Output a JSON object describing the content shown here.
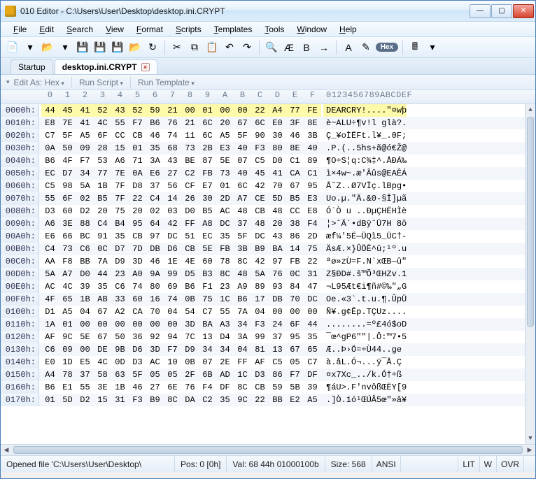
{
  "window": {
    "title": "010 Editor - C:\\Users\\User\\Desktop\\desktop.ini.CRYPT"
  },
  "menu": [
    "File",
    "Edit",
    "Search",
    "View",
    "Format",
    "Scripts",
    "Templates",
    "Tools",
    "Window",
    "Help"
  ],
  "tabs": [
    {
      "label": "Startup",
      "active": false,
      "closable": false
    },
    {
      "label": "desktop.ini.CRYPT",
      "active": true,
      "closable": true
    }
  ],
  "filterbar": {
    "edit_as": "Edit As: Hex",
    "run_script": "Run Script",
    "run_template": "Run Template"
  },
  "column_header": {
    "hex": [
      "0",
      "1",
      "2",
      "3",
      "4",
      "5",
      "6",
      "7",
      "8",
      "9",
      "A",
      "B",
      "C",
      "D",
      "E",
      "F"
    ],
    "ascii": "0123456789ABCDEF"
  },
  "hex_rows": [
    {
      "addr": "0000h:",
      "hex": [
        "44",
        "45",
        "41",
        "52",
        "43",
        "52",
        "59",
        "21",
        "00",
        "01",
        "00",
        "00",
        "22",
        "A4",
        "77",
        "FE"
      ],
      "ascii": "DEARCRY!....\"¤wþ",
      "hl": true
    },
    {
      "addr": "0010h:",
      "hex": [
        "E8",
        "7E",
        "41",
        "4C",
        "55",
        "F7",
        "B6",
        "76",
        "21",
        "6C",
        "20",
        "67",
        "6C",
        "E0",
        "3F",
        "8E"
      ],
      "ascii": "è~ALU÷¶v!l glà?.",
      "hl": false
    },
    {
      "addr": "0020h:",
      "hex": [
        "C7",
        "5F",
        "A5",
        "6F",
        "CC",
        "CB",
        "46",
        "74",
        "11",
        "6C",
        "A5",
        "5F",
        "90",
        "30",
        "46",
        "3B"
      ],
      "ascii": "Ç_¥oÌËFt.l¥_.0F;",
      "hl": false
    },
    {
      "addr": "0030h:",
      "hex": [
        "0A",
        "50",
        "09",
        "28",
        "15",
        "01",
        "35",
        "68",
        "73",
        "2B",
        "E3",
        "40",
        "F3",
        "80",
        "8E",
        "40"
      ],
      "ascii": ".P.(..5hs+ã@ó€Ž@",
      "hl": false
    },
    {
      "addr": "0040h:",
      "hex": [
        "B6",
        "4F",
        "F7",
        "53",
        "A6",
        "71",
        "3A",
        "43",
        "BE",
        "87",
        "5E",
        "07",
        "C5",
        "D0",
        "C1",
        "89"
      ],
      "ascii": "¶O÷S¦q:C¾‡^.ÅÐÁ‰",
      "hl": false
    },
    {
      "addr": "0050h:",
      "hex": [
        "EC",
        "D7",
        "34",
        "77",
        "7E",
        "0A",
        "E6",
        "27",
        "C2",
        "FB",
        "73",
        "40",
        "45",
        "41",
        "CA",
        "C1"
      ],
      "ascii": "ì×4w~.æ'Âûs@EAÊÁ",
      "hl": false
    },
    {
      "addr": "0060h:",
      "hex": [
        "C5",
        "98",
        "5A",
        "1B",
        "7F",
        "D8",
        "37",
        "56",
        "CF",
        "E7",
        "01",
        "6C",
        "42",
        "70",
        "67",
        "95"
      ],
      "ascii": "Å˜Z..Ø7VÏç.lBpg•",
      "hl": false
    },
    {
      "addr": "0070h:",
      "hex": [
        "55",
        "6F",
        "02",
        "B5",
        "7F",
        "22",
        "C4",
        "14",
        "26",
        "30",
        "2D",
        "A7",
        "CE",
        "5D",
        "B5",
        "E3"
      ],
      "ascii": "Uo.µ.\"Ä.&0-§Î]µã",
      "hl": false
    },
    {
      "addr": "0080h:",
      "hex": [
        "D3",
        "60",
        "D2",
        "20",
        "75",
        "20",
        "02",
        "03",
        "D0",
        "B5",
        "AC",
        "48",
        "CB",
        "48",
        "CC",
        "E8"
      ],
      "ascii": "Ó`Ò u ..ÐµÇHËHÌè",
      "hl": false
    },
    {
      "addr": "0090h:",
      "hex": [
        "A6",
        "3E",
        "88",
        "C4",
        "B4",
        "95",
        "64",
        "42",
        "FF",
        "A8",
        "DC",
        "37",
        "48",
        "20",
        "38",
        "F4"
      ],
      "ascii": "¦>ˆÄ´•dBÿ¨Ü7H 8ô",
      "hl": false
    },
    {
      "addr": "00A0h:",
      "hex": [
        "E6",
        "66",
        "BC",
        "91",
        "35",
        "CB",
        "97",
        "DC",
        "51",
        "EC",
        "35",
        "5F",
        "DC",
        "43",
        "86",
        "2D"
      ],
      "ascii": "æf¼'5Ë—ÜQì5_ÜC†-",
      "hl": false
    },
    {
      "addr": "00B0h:",
      "hex": [
        "C4",
        "73",
        "C6",
        "0C",
        "D7",
        "7D",
        "DB",
        "D6",
        "CB",
        "5E",
        "FB",
        "3B",
        "B9",
        "BA",
        "14",
        "75"
      ],
      "ascii": "ÄsÆ.×}ÛÖË^û;¹º.u",
      "hl": false
    },
    {
      "addr": "00C0h:",
      "hex": [
        "AA",
        "F8",
        "BB",
        "7A",
        "D9",
        "3D",
        "46",
        "1E",
        "4E",
        "60",
        "78",
        "8C",
        "42",
        "97",
        "FB",
        "22"
      ],
      "ascii": "ªø»zÙ=F.N`xŒB—û\"",
      "hl": false
    },
    {
      "addr": "00D0h:",
      "hex": [
        "5A",
        "A7",
        "D0",
        "44",
        "23",
        "A0",
        "9A",
        "99",
        "D5",
        "B3",
        "8C",
        "48",
        "5A",
        "76",
        "0C",
        "31"
      ],
      "ascii": "Z§ÐD#.š™Õ³ŒHZv.1",
      "hl": false
    },
    {
      "addr": "00E0h:",
      "hex": [
        "AC",
        "4C",
        "39",
        "35",
        "C6",
        "74",
        "80",
        "69",
        "B6",
        "F1",
        "23",
        "A9",
        "89",
        "93",
        "84",
        "47"
      ],
      "ascii": "¬L95Æt€i¶ñ#©‰\"„G",
      "hl": false
    },
    {
      "addr": "00F0h:",
      "hex": [
        "4F",
        "65",
        "1B",
        "AB",
        "33",
        "60",
        "16",
        "74",
        "0B",
        "75",
        "1C",
        "B6",
        "17",
        "DB",
        "70",
        "DC"
      ],
      "ascii": "Oe.«3`.t.u.¶.ÛpÜ",
      "hl": false
    },
    {
      "addr": "0100h:",
      "hex": [
        "D1",
        "A5",
        "04",
        "67",
        "A2",
        "CA",
        "70",
        "04",
        "54",
        "C7",
        "55",
        "7A",
        "04",
        "00",
        "00",
        "00"
      ],
      "ascii": "Ñ¥.g¢Êp.TÇUz....",
      "hl": false
    },
    {
      "addr": "0110h:",
      "hex": [
        "1A",
        "01",
        "00",
        "00",
        "00",
        "00",
        "00",
        "00",
        "3D",
        "BA",
        "A3",
        "34",
        "F3",
        "24",
        "6F",
        "44"
      ],
      "ascii": "........=º£4ó$oD",
      "hl": false
    },
    {
      "addr": "0120h:",
      "hex": [
        "AF",
        "9C",
        "5E",
        "67",
        "50",
        "36",
        "92",
        "94",
        "7C",
        "13",
        "D4",
        "3A",
        "99",
        "37",
        "95",
        "35"
      ],
      "ascii": "¯œ^gP6\"\"|.Ô:™7•5",
      "hl": false
    },
    {
      "addr": "0130h:",
      "hex": [
        "C6",
        "09",
        "00",
        "DE",
        "9B",
        "D6",
        "3D",
        "F7",
        "D9",
        "34",
        "34",
        "04",
        "81",
        "13",
        "67",
        "65"
      ],
      "ascii": "Æ..Þ›Ö=÷Ù44..ge",
      "hl": false
    },
    {
      "addr": "0140h:",
      "hex": [
        "E0",
        "1D",
        "E5",
        "4C",
        "0D",
        "D3",
        "AC",
        "10",
        "0B",
        "07",
        "2E",
        "FF",
        "AF",
        "C5",
        "05",
        "C7"
      ],
      "ascii": "à.åL.Ó¬...ÿ¯Å.Ç",
      "hl": false
    },
    {
      "addr": "0150h:",
      "hex": [
        "A4",
        "78",
        "37",
        "58",
        "63",
        "5F",
        "05",
        "05",
        "2F",
        "6B",
        "AD",
        "1C",
        "D3",
        "86",
        "F7",
        "DF"
      ],
      "ascii": "¤x7Xc_../k­.Ó†÷ß",
      "hl": false
    },
    {
      "addr": "0160h:",
      "hex": [
        "B6",
        "E1",
        "55",
        "3E",
        "1B",
        "46",
        "27",
        "6E",
        "76",
        "F4",
        "DF",
        "8C",
        "CB",
        "59",
        "5B",
        "39"
      ],
      "ascii": "¶áU>.F'nvôßŒËY[9",
      "hl": false
    },
    {
      "addr": "0170h:",
      "hex": [
        "01",
        "5D",
        "D2",
        "15",
        "31",
        "F3",
        "B9",
        "8C",
        "DA",
        "C2",
        "35",
        "9C",
        "22",
        "BB",
        "E2",
        "A5"
      ],
      "ascii": ".]Ò.1ó¹ŒÚÂ5œ\"»â¥",
      "hl": false
    }
  ],
  "status": {
    "file": "Opened file 'C:\\Users\\User\\Desktop\\",
    "pos": "Pos: 0 [0h]",
    "val": "Val: 68 44h 01000100b",
    "size": "Size: 568",
    "encoding": "ANSI",
    "lit": "LIT",
    "w": "W",
    "ovr": "OVR"
  },
  "toolbar_icons": [
    {
      "name": "new-icon",
      "glyph": "📄"
    },
    {
      "name": "dropdown-icon",
      "glyph": "▾"
    },
    {
      "name": "open-icon",
      "glyph": "📂"
    },
    {
      "name": "dropdown-icon",
      "glyph": "▾"
    },
    {
      "name": "save-icon",
      "glyph": "💾"
    },
    {
      "name": "save-all-icon",
      "glyph": "💾"
    },
    {
      "name": "save-as-icon",
      "glyph": "💾"
    },
    {
      "name": "print-icon",
      "glyph": "📂"
    },
    {
      "name": "revert-icon",
      "glyph": "↻"
    },
    {
      "name": "sep"
    },
    {
      "name": "cut-icon",
      "glyph": "✂"
    },
    {
      "name": "copy-icon",
      "glyph": "⧉"
    },
    {
      "name": "paste-icon",
      "glyph": "📋"
    },
    {
      "name": "undo-icon",
      "glyph": "↶"
    },
    {
      "name": "redo-icon",
      "glyph": "↷"
    },
    {
      "name": "sep"
    },
    {
      "name": "find-icon",
      "glyph": "🔍"
    },
    {
      "name": "find-replace-icon",
      "glyph": "Æ"
    },
    {
      "name": "find-next-icon",
      "glyph": "B"
    },
    {
      "name": "goto-icon",
      "glyph": "→"
    },
    {
      "name": "sep"
    },
    {
      "name": "font-icon",
      "glyph": "A"
    },
    {
      "name": "highlight-icon",
      "glyph": "✎"
    },
    {
      "name": "hex-toggle",
      "glyph": "Hex",
      "pill": true
    },
    {
      "name": "sep"
    },
    {
      "name": "calculator-icon",
      "glyph": "🖩"
    },
    {
      "name": "dropdown-icon",
      "glyph": "▾"
    }
  ]
}
